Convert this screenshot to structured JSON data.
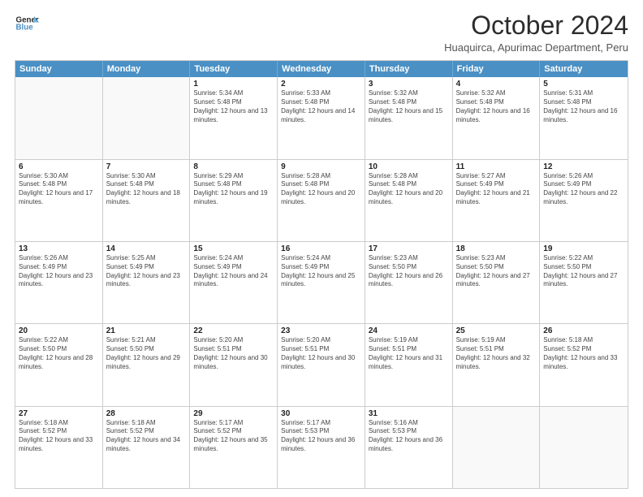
{
  "logo": {
    "line1": "General",
    "line2": "Blue",
    "icon_color": "#4a90c4"
  },
  "title": "October 2024",
  "subtitle": "Huaquirca, Apurimac Department, Peru",
  "header_days": [
    "Sunday",
    "Monday",
    "Tuesday",
    "Wednesday",
    "Thursday",
    "Friday",
    "Saturday"
  ],
  "weeks": [
    [
      {
        "day": "",
        "sunrise": "",
        "sunset": "",
        "daylight": ""
      },
      {
        "day": "",
        "sunrise": "",
        "sunset": "",
        "daylight": ""
      },
      {
        "day": "1",
        "sunrise": "Sunrise: 5:34 AM",
        "sunset": "Sunset: 5:48 PM",
        "daylight": "Daylight: 12 hours and 13 minutes."
      },
      {
        "day": "2",
        "sunrise": "Sunrise: 5:33 AM",
        "sunset": "Sunset: 5:48 PM",
        "daylight": "Daylight: 12 hours and 14 minutes."
      },
      {
        "day": "3",
        "sunrise": "Sunrise: 5:32 AM",
        "sunset": "Sunset: 5:48 PM",
        "daylight": "Daylight: 12 hours and 15 minutes."
      },
      {
        "day": "4",
        "sunrise": "Sunrise: 5:32 AM",
        "sunset": "Sunset: 5:48 PM",
        "daylight": "Daylight: 12 hours and 16 minutes."
      },
      {
        "day": "5",
        "sunrise": "Sunrise: 5:31 AM",
        "sunset": "Sunset: 5:48 PM",
        "daylight": "Daylight: 12 hours and 16 minutes."
      }
    ],
    [
      {
        "day": "6",
        "sunrise": "Sunrise: 5:30 AM",
        "sunset": "Sunset: 5:48 PM",
        "daylight": "Daylight: 12 hours and 17 minutes."
      },
      {
        "day": "7",
        "sunrise": "Sunrise: 5:30 AM",
        "sunset": "Sunset: 5:48 PM",
        "daylight": "Daylight: 12 hours and 18 minutes."
      },
      {
        "day": "8",
        "sunrise": "Sunrise: 5:29 AM",
        "sunset": "Sunset: 5:48 PM",
        "daylight": "Daylight: 12 hours and 19 minutes."
      },
      {
        "day": "9",
        "sunrise": "Sunrise: 5:28 AM",
        "sunset": "Sunset: 5:48 PM",
        "daylight": "Daylight: 12 hours and 20 minutes."
      },
      {
        "day": "10",
        "sunrise": "Sunrise: 5:28 AM",
        "sunset": "Sunset: 5:48 PM",
        "daylight": "Daylight: 12 hours and 20 minutes."
      },
      {
        "day": "11",
        "sunrise": "Sunrise: 5:27 AM",
        "sunset": "Sunset: 5:49 PM",
        "daylight": "Daylight: 12 hours and 21 minutes."
      },
      {
        "day": "12",
        "sunrise": "Sunrise: 5:26 AM",
        "sunset": "Sunset: 5:49 PM",
        "daylight": "Daylight: 12 hours and 22 minutes."
      }
    ],
    [
      {
        "day": "13",
        "sunrise": "Sunrise: 5:26 AM",
        "sunset": "Sunset: 5:49 PM",
        "daylight": "Daylight: 12 hours and 23 minutes."
      },
      {
        "day": "14",
        "sunrise": "Sunrise: 5:25 AM",
        "sunset": "Sunset: 5:49 PM",
        "daylight": "Daylight: 12 hours and 23 minutes."
      },
      {
        "day": "15",
        "sunrise": "Sunrise: 5:24 AM",
        "sunset": "Sunset: 5:49 PM",
        "daylight": "Daylight: 12 hours and 24 minutes."
      },
      {
        "day": "16",
        "sunrise": "Sunrise: 5:24 AM",
        "sunset": "Sunset: 5:49 PM",
        "daylight": "Daylight: 12 hours and 25 minutes."
      },
      {
        "day": "17",
        "sunrise": "Sunrise: 5:23 AM",
        "sunset": "Sunset: 5:50 PM",
        "daylight": "Daylight: 12 hours and 26 minutes."
      },
      {
        "day": "18",
        "sunrise": "Sunrise: 5:23 AM",
        "sunset": "Sunset: 5:50 PM",
        "daylight": "Daylight: 12 hours and 27 minutes."
      },
      {
        "day": "19",
        "sunrise": "Sunrise: 5:22 AM",
        "sunset": "Sunset: 5:50 PM",
        "daylight": "Daylight: 12 hours and 27 minutes."
      }
    ],
    [
      {
        "day": "20",
        "sunrise": "Sunrise: 5:22 AM",
        "sunset": "Sunset: 5:50 PM",
        "daylight": "Daylight: 12 hours and 28 minutes."
      },
      {
        "day": "21",
        "sunrise": "Sunrise: 5:21 AM",
        "sunset": "Sunset: 5:50 PM",
        "daylight": "Daylight: 12 hours and 29 minutes."
      },
      {
        "day": "22",
        "sunrise": "Sunrise: 5:20 AM",
        "sunset": "Sunset: 5:51 PM",
        "daylight": "Daylight: 12 hours and 30 minutes."
      },
      {
        "day": "23",
        "sunrise": "Sunrise: 5:20 AM",
        "sunset": "Sunset: 5:51 PM",
        "daylight": "Daylight: 12 hours and 30 minutes."
      },
      {
        "day": "24",
        "sunrise": "Sunrise: 5:19 AM",
        "sunset": "Sunset: 5:51 PM",
        "daylight": "Daylight: 12 hours and 31 minutes."
      },
      {
        "day": "25",
        "sunrise": "Sunrise: 5:19 AM",
        "sunset": "Sunset: 5:51 PM",
        "daylight": "Daylight: 12 hours and 32 minutes."
      },
      {
        "day": "26",
        "sunrise": "Sunrise: 5:18 AM",
        "sunset": "Sunset: 5:52 PM",
        "daylight": "Daylight: 12 hours and 33 minutes."
      }
    ],
    [
      {
        "day": "27",
        "sunrise": "Sunrise: 5:18 AM",
        "sunset": "Sunset: 5:52 PM",
        "daylight": "Daylight: 12 hours and 33 minutes."
      },
      {
        "day": "28",
        "sunrise": "Sunrise: 5:18 AM",
        "sunset": "Sunset: 5:52 PM",
        "daylight": "Daylight: 12 hours and 34 minutes."
      },
      {
        "day": "29",
        "sunrise": "Sunrise: 5:17 AM",
        "sunset": "Sunset: 5:52 PM",
        "daylight": "Daylight: 12 hours and 35 minutes."
      },
      {
        "day": "30",
        "sunrise": "Sunrise: 5:17 AM",
        "sunset": "Sunset: 5:53 PM",
        "daylight": "Daylight: 12 hours and 36 minutes."
      },
      {
        "day": "31",
        "sunrise": "Sunrise: 5:16 AM",
        "sunset": "Sunset: 5:53 PM",
        "daylight": "Daylight: 12 hours and 36 minutes."
      },
      {
        "day": "",
        "sunrise": "",
        "sunset": "",
        "daylight": ""
      },
      {
        "day": "",
        "sunrise": "",
        "sunset": "",
        "daylight": ""
      }
    ]
  ]
}
